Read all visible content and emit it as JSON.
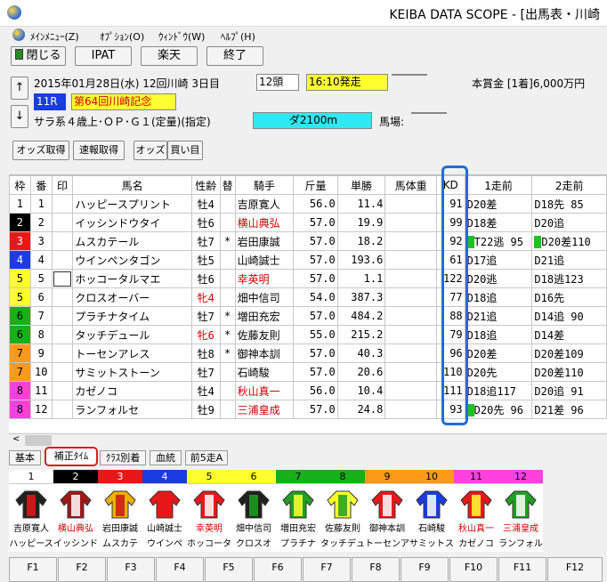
{
  "window": {
    "title": "KEIBA DATA SCOPE - [出馬表・川崎"
  },
  "menu": [
    {
      "label": "ﾒｲﾝﾒﾆｭｰ(Z)"
    },
    {
      "label": "ｵﾌﾟｼｮﾝ(O)"
    },
    {
      "label": "ｳｨﾝﾄﾞｳ(W)"
    },
    {
      "label": "ﾍﾙﾌﾟ(H)"
    }
  ],
  "toolbar": {
    "close_label": "閉じる",
    "ipat_label": "IPAT",
    "rakuten_label": "楽天",
    "exit_label": "終了"
  },
  "race": {
    "date_venue": "2015年01月28日(水) 12回川崎 3日目",
    "heads": "12頭",
    "post_time": "16:10発走",
    "prize": "本賞金 [1着]6,000万円",
    "race_no": "11R",
    "race_name": "第64回川崎記念",
    "conditions": "サラ系４歳上･ＯＰ･Ｇ１(定量)(指定)",
    "course": "ダ2100m",
    "track_label": "馬場:",
    "up_arrow": "↑",
    "down_arrow": "↓"
  },
  "actions": {
    "odds_fetch": "オッズ取得",
    "flash_fetch": "速報取得",
    "odds": "オッズ",
    "buy": "買い目"
  },
  "columns": [
    "枠",
    "番",
    "印",
    "馬名",
    "性齢",
    "替",
    "騎手",
    "斤量",
    "単勝",
    "馬体重",
    "KD",
    "1走前",
    "2走前"
  ],
  "rows": [
    {
      "waku": "1",
      "ban": "1",
      "name": "ハッピースプリント",
      "sexage": "牡4",
      "change": "",
      "jockey": "吉原寛人",
      "weight": "56.0",
      "odds": "11.4",
      "kd": "91",
      "prev1": "D20差",
      "prev2": "D18先 85"
    },
    {
      "waku": "2",
      "ban": "2",
      "name": "イッシンドウタイ",
      "sexage": "牡6",
      "change": "",
      "jockey": "横山典弘",
      "weight": "57.0",
      "odds": "19.9",
      "kd": "99",
      "prev1": "D18差",
      "prev2": "D20追"
    },
    {
      "waku": "3",
      "ban": "3",
      "name": "ムスカテール",
      "sexage": "牡7",
      "change": "*",
      "jockey": "岩田康誠",
      "weight": "57.0",
      "odds": "18.2",
      "kd": "92",
      "prev1": "T22逃 95",
      "prev2": "D20差110"
    },
    {
      "waku": "4",
      "ban": "4",
      "name": "ウインペンタゴン",
      "sexage": "牡5",
      "change": "",
      "jockey": "山崎誠士",
      "weight": "57.0",
      "odds": "193.6",
      "kd": "61",
      "prev1": "D17追",
      "prev2": "D21追"
    },
    {
      "waku": "5",
      "ban": "5",
      "name": "ホッコータルマエ",
      "sexage": "牡6",
      "change": "",
      "jockey": "幸英明",
      "weight": "57.0",
      "odds": "1.1",
      "kd": "122",
      "prev1": "D20逃",
      "prev2": "D18逃123"
    },
    {
      "waku": "5",
      "ban": "6",
      "name": "クロスオーバー",
      "sexage": "牝4",
      "change": "",
      "jockey": "畑中信司",
      "weight": "54.0",
      "odds": "387.3",
      "kd": "77",
      "prev1": "D18追",
      "prev2": "D16先"
    },
    {
      "waku": "6",
      "ban": "7",
      "name": "プラチナタイム",
      "sexage": "牡7",
      "change": "*",
      "jockey": "増田充宏",
      "weight": "57.0",
      "odds": "484.2",
      "kd": "88",
      "prev1": "D21追",
      "prev2": "D14追 90"
    },
    {
      "waku": "6",
      "ban": "8",
      "name": "タッチデュール",
      "sexage": "牝6",
      "change": "*",
      "jockey": "佐藤友則",
      "weight": "55.0",
      "odds": "215.2",
      "kd": "79",
      "prev1": "D18追",
      "prev2": "D14差"
    },
    {
      "waku": "7",
      "ban": "9",
      "name": "トーセンアレス",
      "sexage": "牡8",
      "change": "*",
      "jockey": "御神本訓",
      "weight": "57.0",
      "odds": "40.3",
      "kd": "96",
      "prev1": "D20差",
      "prev2": "D20差109"
    },
    {
      "waku": "7",
      "ban": "10",
      "name": "サミットストーン",
      "sexage": "牡7",
      "change": "",
      "jockey": "石崎駿",
      "weight": "57.0",
      "odds": "20.6",
      "kd": "110",
      "prev1": "D20先",
      "prev2": "D20差110"
    },
    {
      "waku": "8",
      "ban": "11",
      "name": "カゼノコ",
      "sexage": "牡4",
      "change": "",
      "jockey": "秋山真一",
      "weight": "56.0",
      "odds": "10.4",
      "kd": "111",
      "prev1": "D18追117",
      "prev2": "D20追 91"
    },
    {
      "waku": "8",
      "ban": "12",
      "name": "ランフォルセ",
      "sexage": "牡9",
      "change": "",
      "jockey": "三浦皇成",
      "weight": "57.0",
      "odds": "24.8",
      "kd": "93",
      "prev1": "D20先 96",
      "prev2": "D21差 96"
    }
  ],
  "tabs": [
    "基本",
    "補正ﾀｲﾑ",
    "ｸﾗｽ別着",
    "血統",
    "前5走A"
  ],
  "horses": [
    {
      "num": "1",
      "jockey": "吉原寛人",
      "horse": "ハッピース"
    },
    {
      "num": "2",
      "jockey": "横山典弘",
      "horse": "イッシンド"
    },
    {
      "num": "3",
      "jockey": "岩田康誠",
      "horse": "ムスカテ"
    },
    {
      "num": "4",
      "jockey": "山崎誠士",
      "horse": "ウインペ"
    },
    {
      "num": "5",
      "jockey": "幸英明",
      "horse": "ホッコータ"
    },
    {
      "num": "6",
      "jockey": "畑中信司",
      "horse": "クロスオ"
    },
    {
      "num": "7",
      "jockey": "増田充宏",
      "horse": "プラチナ"
    },
    {
      "num": "8",
      "jockey": "佐藤友則",
      "horse": "タッチデュ"
    },
    {
      "num": "9",
      "jockey": "御神本訓",
      "horse": "トーセンア"
    },
    {
      "num": "10",
      "jockey": "石崎駿",
      "horse": "サミットス"
    },
    {
      "num": "11",
      "jockey": "秋山真一",
      "horse": "カゼノコ"
    },
    {
      "num": "12",
      "jockey": "三浦皇成",
      "horse": "ランフォル"
    }
  ],
  "fkeys": [
    "F1",
    "F2",
    "F3",
    "F4",
    "F5",
    "F6",
    "F7",
    "F8",
    "F9",
    "F10",
    "F11",
    "F12"
  ],
  "colors": {
    "waku": {
      "1": "#ffffff",
      "2": "#000000",
      "3": "#e81818",
      "4": "#1a3ce0",
      "5": "#ffff30",
      "6": "#18b018",
      "7": "#ff9a18",
      "8": "#ff40e0"
    },
    "race_name_bg": "#ffff30",
    "course_bg": "#30e8f0",
    "race_no_bg": "#1a3ce0",
    "kd_highlight": "#1e6fd8",
    "tab_highlight": "#d82020"
  }
}
